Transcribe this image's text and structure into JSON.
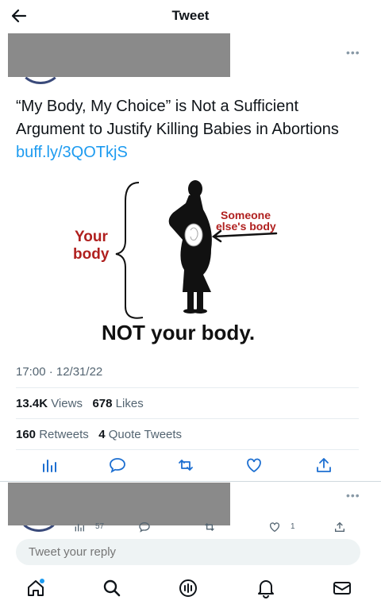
{
  "header": {
    "title": "Tweet"
  },
  "tweet": {
    "text": "“My Body, My Choice” is Not a Sufficient Argument to Justify Killing Babies in Abortions ",
    "link": "buff.ly/3QOTkjS",
    "image": {
      "label_your_body": [
        "Your",
        "body"
      ],
      "label_someone": [
        "Someone",
        "else's body"
      ],
      "caption": "NOT your body."
    },
    "timestamp": "17:00 · 12/31/22",
    "views_count": "13.4K",
    "views_label": "Views",
    "likes_count": "678",
    "likes_label": "Likes",
    "retweets_count": "160",
    "retweets_label": "Retweets",
    "quotes_count": "4",
    "quotes_label": "Quote Tweets"
  },
  "reply_preview": {
    "views": "57",
    "likes": "1"
  },
  "reply_input": {
    "placeholder": "Tweet your reply"
  },
  "colors": {
    "link": "#1d9bf0",
    "muted": "#536471",
    "redaction": "#8a8a8a"
  },
  "icons": [
    "back-arrow-icon",
    "more-icon",
    "analytics-icon",
    "comment-icon",
    "retweet-icon",
    "heart-icon",
    "share-icon",
    "home-icon",
    "search-icon",
    "spaces-icon",
    "notifications-icon",
    "messages-icon"
  ]
}
